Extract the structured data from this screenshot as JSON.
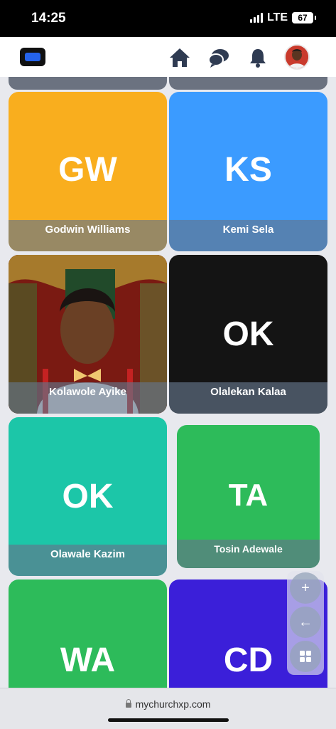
{
  "status_bar": {
    "time": "14:25",
    "network": "LTE",
    "battery": "67"
  },
  "header": {
    "icons": {
      "home": "home-icon",
      "chat": "chat-icon",
      "notifications": "bell-icon"
    },
    "accent_color": "#2f3b52"
  },
  "cards": [
    {
      "initials": "GW",
      "name": "Godwin Williams",
      "color": "#f9ae1e"
    },
    {
      "initials": "KS",
      "name": "Kemi Sela",
      "color": "#3b9bff"
    },
    {
      "initials": "",
      "name": "Kolawole Ayike",
      "color": "#8b1a14",
      "photo": true
    },
    {
      "initials": "OK",
      "name": "Olalekan Kalaa",
      "color": "#141414"
    },
    {
      "initials": "OK",
      "name": "Olawale Kazim",
      "color": "#1cc6a8"
    },
    {
      "initials": "TA",
      "name": "Tosin Adewale",
      "color": "#2dbb5a"
    },
    {
      "initials": "WA",
      "name": "",
      "color": "#2dbb5a"
    },
    {
      "initials": "CD",
      "name": "",
      "color": "#3b1fd9"
    }
  ],
  "fab": {
    "add": "+",
    "back": "←",
    "grid": "grid-icon"
  },
  "browser": {
    "url": "mychurchxp.com"
  }
}
